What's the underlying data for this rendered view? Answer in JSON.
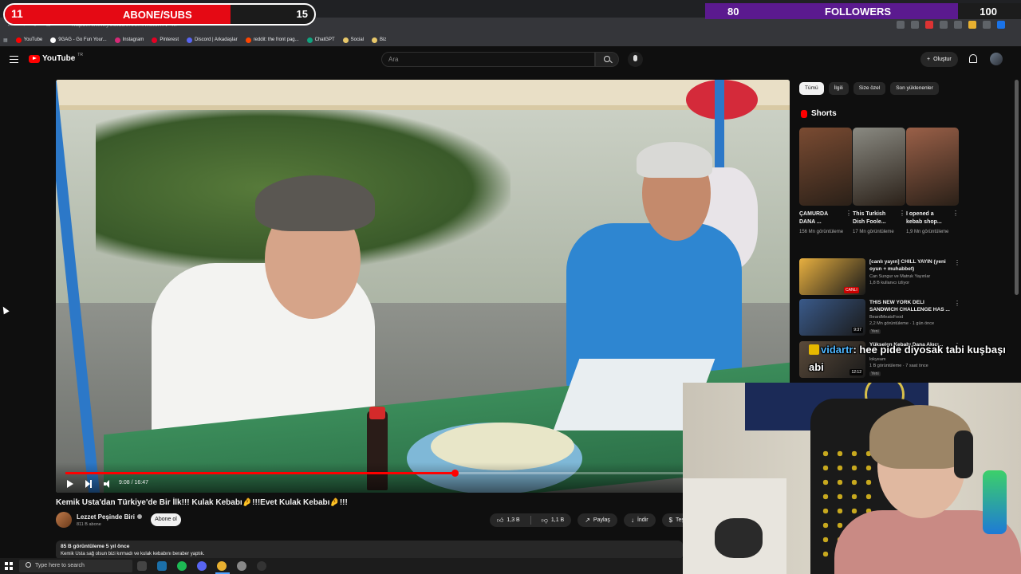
{
  "browser": {
    "url": "https://www.youtube.com/watch?v=...",
    "bookmarks": [
      {
        "label": "YouTube",
        "color": "#ff0000"
      },
      {
        "label": "9GAG - Go Fun Your...",
        "color": "#ffffff"
      },
      {
        "label": "Instagram",
        "color": "#d62976"
      },
      {
        "label": "Pinterest",
        "color": "#e60023"
      },
      {
        "label": "Discord | Arkadaşlar",
        "color": "#5865f2"
      },
      {
        "label": "reddit: the front pag...",
        "color": "#ff4500"
      },
      {
        "label": "ChatGPT",
        "color": "#10a37f"
      },
      {
        "label": "Social",
        "color": "#e8c86a"
      },
      {
        "label": "Biz",
        "color": "#e8c86a"
      }
    ]
  },
  "overlay": {
    "subs": {
      "current": "11",
      "label": "ABONE/SUBS",
      "goal": "15",
      "progress": 0.73,
      "color": "#e50914"
    },
    "followers": {
      "current": "80",
      "label": "FOLLOWERS",
      "goal": "100",
      "progress": 0.8,
      "color": "#5b1a8f"
    }
  },
  "header": {
    "logo_text": "YouTube",
    "logo_country": "TR",
    "search_placeholder": "Ara",
    "create_label": "Oluştur"
  },
  "player": {
    "time": "9:08 / 16:47",
    "progress": 0.545
  },
  "video": {
    "title": "Kemik Usta'dan Türkiye'de Bir İlk!!! Kulak Kebabı🤌!!!Evet Kulak Kebabı🤌!!!",
    "channel": "Lezzet Peşinde Biri",
    "subscribers": "811 B abone",
    "subscribe_label": "Abone ol",
    "likes": "1,3 B",
    "dislikes": "1,1 B",
    "share_label": "Paylaş",
    "download_label": "İndir",
    "thanks_label": "Teşekkür",
    "views_meta": "85 B görüntüleme  5 yıl önce",
    "description": "Kemik Usta sağ olsun bizi kırmadı ve kulak kebabını beraber yaptık."
  },
  "sidebar": {
    "chips": [
      "Tümü",
      "İlgili",
      "Size özel",
      "Son yüklenenler"
    ],
    "shorts_heading": "Shorts",
    "shorts": [
      {
        "title": "ÇAMURDA DANA ...",
        "views": "156 Mn görüntüleme",
        "color": "#7a4b32"
      },
      {
        "title": "This Turkish Dish Foole...",
        "views": "17 Mn görüntüleme",
        "color": "#8a8a82"
      },
      {
        "title": "I opened a kebab shop...",
        "views": "1,9 Mn görüntüleme",
        "color": "#9a6048"
      }
    ],
    "recommendations": [
      {
        "title": "[canlı yayın] CHILL YAYIN (yeni oyun + muhabbet)",
        "channel": "Can Sungur ve Matruk Yayınlar",
        "meta": "1,8 B kullanıcı izliyor",
        "badge": "CANLI",
        "color": "#e8b040"
      },
      {
        "title": "THIS NEW YORK DELI SANDWICH CHALLENGE HAS ...",
        "channel": "BeardMeatsFood",
        "meta": "2,2 Mn görüntüleme · 1 gün önce",
        "badge": "9:37",
        "new": "Yeni",
        "color": "#3a5a8a"
      },
      {
        "title": "Yükselen Kebabı Dana Akıcı...",
        "channel": "lokyeam",
        "meta": "1 B görüntüleme · 7 saat önce",
        "badge": "12:12",
        "new": "Yeni",
        "color": "#5a4a3a"
      }
    ]
  },
  "chat": {
    "user": "vidartr",
    "message": ": hee pide diyosak tabi kuşbaşı abi"
  },
  "taskbar": {
    "search_placeholder": "Type here to search",
    "icons": [
      {
        "name": "task-view-icon",
        "color": "#444444"
      },
      {
        "name": "steam-icon",
        "color": "#1b6fa8"
      },
      {
        "name": "spotify-icon",
        "color": "#1db954"
      },
      {
        "name": "discord-icon",
        "color": "#5865f2"
      },
      {
        "name": "chrome-icon",
        "color": "#e8b030"
      },
      {
        "name": "settings-icon",
        "color": "#888888"
      },
      {
        "name": "obs-icon",
        "color": "#333333"
      }
    ]
  }
}
